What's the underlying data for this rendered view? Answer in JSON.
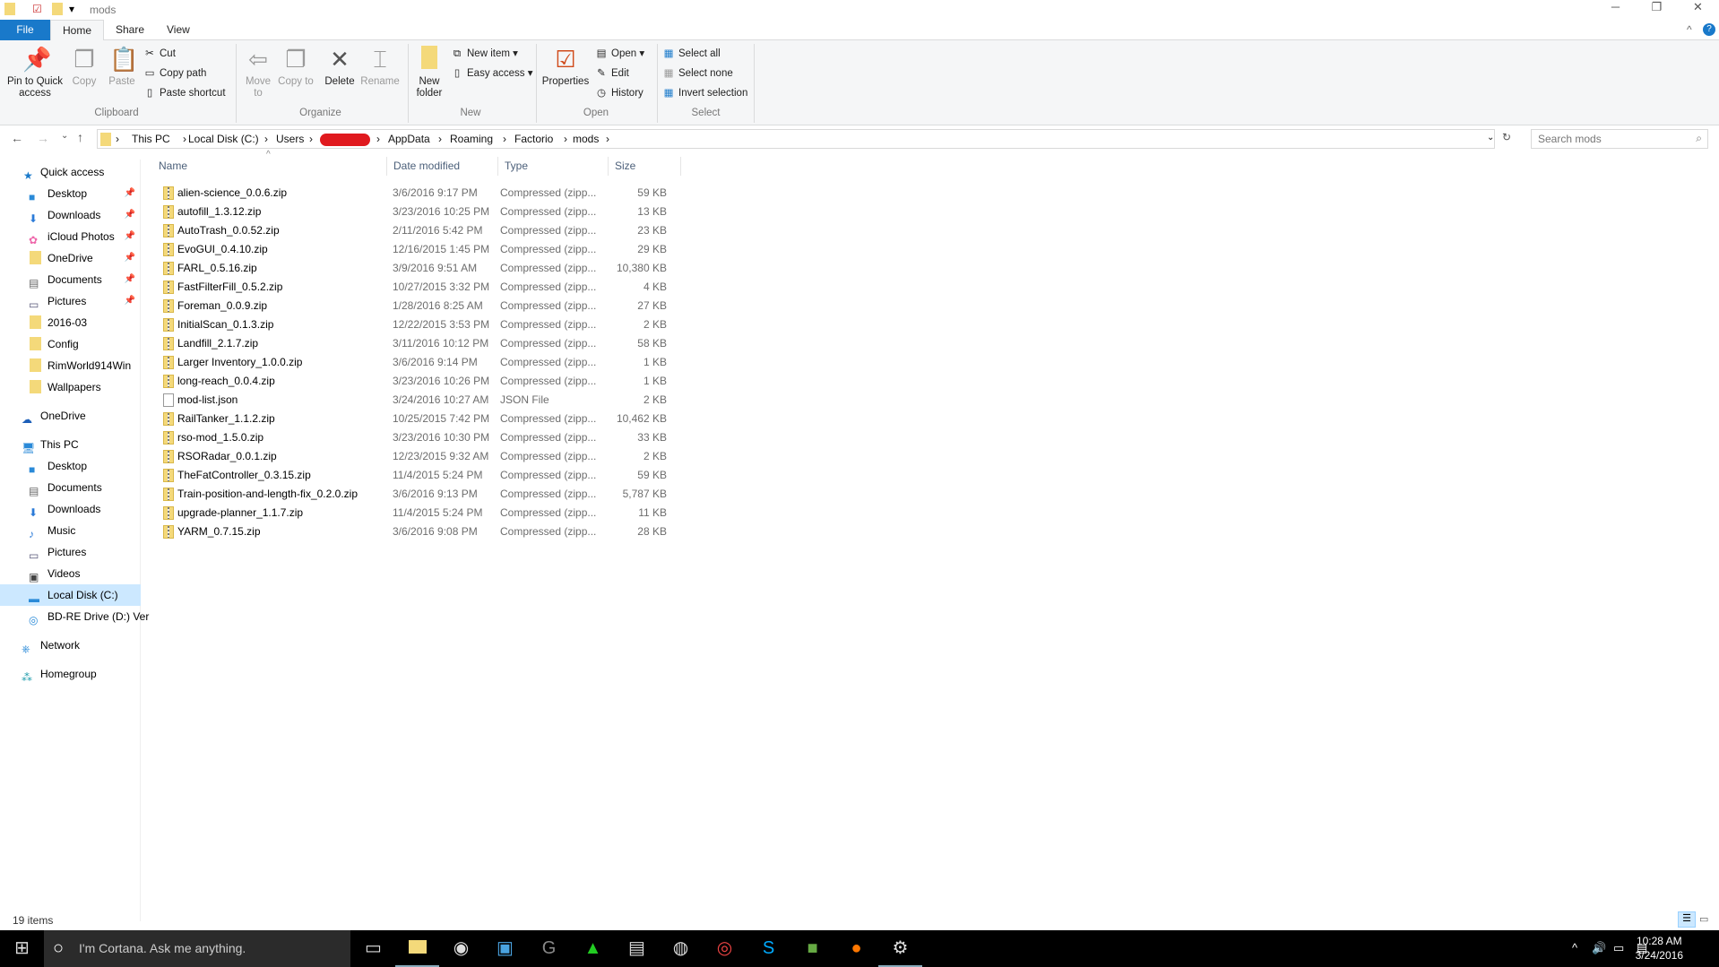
{
  "window": {
    "title": "mods",
    "minimize": "─",
    "maximize": "❐",
    "close": "✕"
  },
  "ribbon_tabs": [
    "File",
    "Home",
    "Share",
    "View"
  ],
  "ribbon": {
    "clipboard": {
      "label": "Clipboard",
      "pin": "Pin to Quick access",
      "copy": "Copy",
      "paste": "Paste",
      "cut": "Cut",
      "copy_path": "Copy path",
      "paste_shortcut": "Paste shortcut"
    },
    "organize": {
      "label": "Organize",
      "move_to": "Move to",
      "copy_to": "Copy to",
      "delete": "Delete",
      "rename": "Rename"
    },
    "new": {
      "label": "New",
      "new_folder": "New folder",
      "new_item": "New item ▾",
      "easy_access": "Easy access ▾"
    },
    "open": {
      "label": "Open",
      "properties": "Properties",
      "open": "Open ▾",
      "edit": "Edit",
      "history": "History"
    },
    "select": {
      "label": "Select",
      "select_all": "Select all",
      "select_none": "Select none",
      "invert": "Invert selection"
    }
  },
  "address": {
    "crumbs": [
      "This PC",
      "Local Disk (C:)",
      "Users",
      "AppData",
      "Roaming",
      "Factorio",
      "mods"
    ],
    "search_placeholder": "Search mods"
  },
  "nav": {
    "quick_access": "Quick access",
    "quick_items": [
      {
        "label": "Desktop",
        "pinned": true
      },
      {
        "label": "Downloads",
        "pinned": true
      },
      {
        "label": "iCloud Photos",
        "pinned": true
      },
      {
        "label": "OneDrive",
        "pinned": true
      },
      {
        "label": "Documents",
        "pinned": true
      },
      {
        "label": "Pictures",
        "pinned": true
      },
      {
        "label": "2016-03"
      },
      {
        "label": "Config"
      },
      {
        "label": "RimWorld914Win"
      },
      {
        "label": "Wallpapers"
      }
    ],
    "onedrive": "OneDrive",
    "this_pc": "This PC",
    "pc_items": [
      "Desktop",
      "Documents",
      "Downloads",
      "Music",
      "Pictures",
      "Videos",
      "Local Disk (C:)",
      "BD-RE Drive (D:) Ver"
    ],
    "network": "Network",
    "homegroup": "Homegroup"
  },
  "columns": [
    "Name",
    "Date modified",
    "Type",
    "Size"
  ],
  "files": [
    [
      "alien-science_0.0.6.zip",
      "3/6/2016 9:17 PM",
      "Compressed (zipp...",
      "59 KB"
    ],
    [
      "autofill_1.3.12.zip",
      "3/23/2016 10:25 PM",
      "Compressed (zipp...",
      "13 KB"
    ],
    [
      "AutoTrash_0.0.52.zip",
      "2/11/2016 5:42 PM",
      "Compressed (zipp...",
      "23 KB"
    ],
    [
      "EvoGUI_0.4.10.zip",
      "12/16/2015 1:45 PM",
      "Compressed (zipp...",
      "29 KB"
    ],
    [
      "FARL_0.5.16.zip",
      "3/9/2016 9:51 AM",
      "Compressed (zipp...",
      "10,380 KB"
    ],
    [
      "FastFilterFill_0.5.2.zip",
      "10/27/2015 3:32 PM",
      "Compressed (zipp...",
      "4 KB"
    ],
    [
      "Foreman_0.0.9.zip",
      "1/28/2016 8:25 AM",
      "Compressed (zipp...",
      "27 KB"
    ],
    [
      "InitialScan_0.1.3.zip",
      "12/22/2015 3:53 PM",
      "Compressed (zipp...",
      "2 KB"
    ],
    [
      "Landfill_2.1.7.zip",
      "3/11/2016 10:12 PM",
      "Compressed (zipp...",
      "58 KB"
    ],
    [
      "Larger Inventory_1.0.0.zip",
      "3/6/2016 9:14 PM",
      "Compressed (zipp...",
      "1 KB"
    ],
    [
      "long-reach_0.0.4.zip",
      "3/23/2016 10:26 PM",
      "Compressed (zipp...",
      "1 KB"
    ],
    [
      "mod-list.json",
      "3/24/2016 10:27 AM",
      "JSON File",
      "2 KB"
    ],
    [
      "RailTanker_1.1.2.zip",
      "10/25/2015 7:42 PM",
      "Compressed (zipp...",
      "10,462 KB"
    ],
    [
      "rso-mod_1.5.0.zip",
      "3/23/2016 10:30 PM",
      "Compressed (zipp...",
      "33 KB"
    ],
    [
      "RSORadar_0.0.1.zip",
      "12/23/2015 9:32 AM",
      "Compressed (zipp...",
      "2 KB"
    ],
    [
      "TheFatController_0.3.15.zip",
      "11/4/2015 5:24 PM",
      "Compressed (zipp...",
      "59 KB"
    ],
    [
      "Train-position-and-length-fix_0.2.0.zip",
      "3/6/2016 9:13 PM",
      "Compressed (zipp...",
      "5,787 KB"
    ],
    [
      "upgrade-planner_1.1.7.zip",
      "11/4/2015 5:24 PM",
      "Compressed (zipp...",
      "11 KB"
    ],
    [
      "YARM_0.7.15.zip",
      "3/6/2016 9:08 PM",
      "Compressed (zipp...",
      "28 KB"
    ]
  ],
  "status": "19 items",
  "taskbar": {
    "cortana": "I'm Cortana. Ask me anything.",
    "time": "10:28 AM",
    "date": "3/24/2016"
  },
  "colors": {
    "accent": "#1979ca",
    "selected": "#cce8ff",
    "taskbar": "#000000"
  }
}
